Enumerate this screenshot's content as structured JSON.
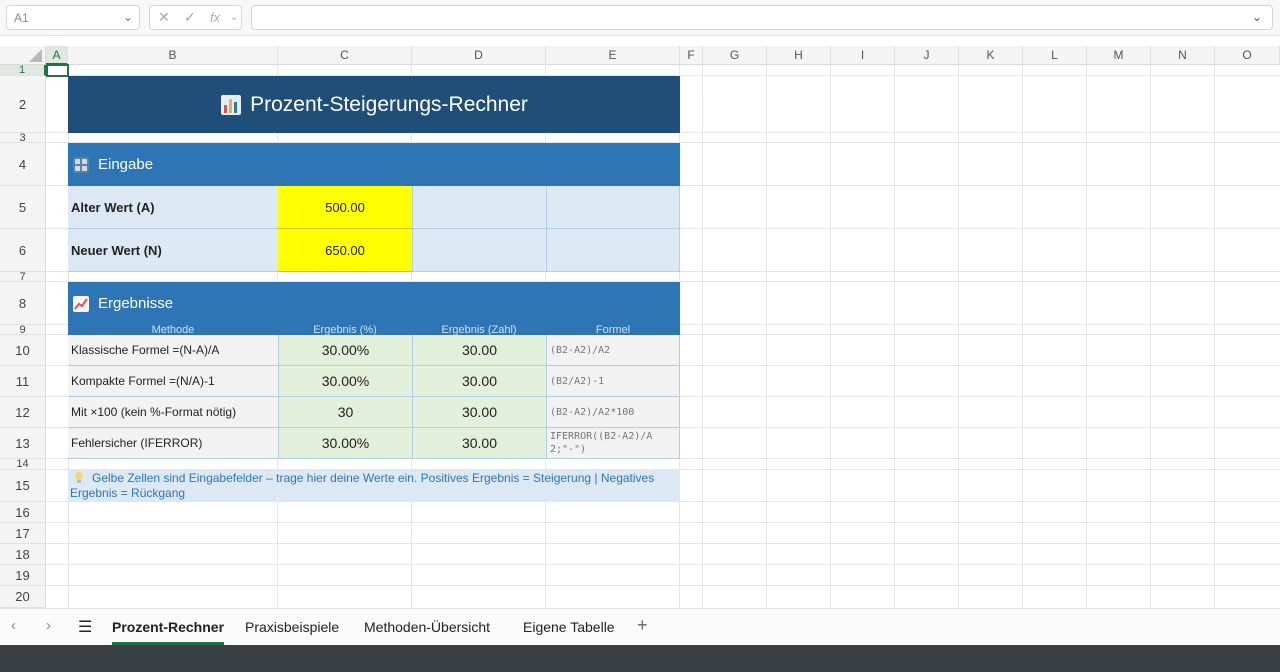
{
  "formula_bar": {
    "name_box": "A1",
    "fx_label": "fx",
    "formula_value": ""
  },
  "columns": [
    "A",
    "B",
    "C",
    "D",
    "E",
    "F",
    "G",
    "H",
    "I",
    "J",
    "K",
    "L",
    "M",
    "N",
    "O"
  ],
  "rows": [
    "1",
    "2",
    "3",
    "4",
    "5",
    "6",
    "7",
    "8",
    "9",
    "10",
    "11",
    "12",
    "13",
    "14",
    "15",
    "16",
    "17",
    "18",
    "19",
    "20"
  ],
  "sheet": {
    "title": "Prozent-Steigerungs-Rechner",
    "input_section": "Eingabe",
    "inputs": [
      {
        "label": "Alter Wert (A)",
        "value": "500.00"
      },
      {
        "label": "Neuer Wert (N)",
        "value": "650.00"
      }
    ],
    "results_section": "Ergebnisse",
    "result_headers": [
      "Methode",
      "Ergebnis (%)",
      "Ergebnis (Zahl)",
      "Formel"
    ],
    "results": [
      {
        "method": "Klassische Formel  =(N-A)/A",
        "percent": "30.00%",
        "number": "30.00",
        "formula": "(B2-A2)/A2"
      },
      {
        "method": "Kompakte Formel  =(N/A)-1",
        "percent": "30.00%",
        "number": "30.00",
        "formula": "(B2/A2)-1"
      },
      {
        "method": "Mit ×100 (kein %-Format nötig)",
        "percent": "30",
        "number": "30.00",
        "formula": "(B2-A2)/A2*100"
      },
      {
        "method": "Fehlersicher (IFERROR)",
        "percent": "30.00%",
        "number": "30.00",
        "formula": "IFERROR((B2-A2)/A2;\"-\")"
      }
    ],
    "note": "Gelbe Zellen sind Eingabefelder – trage hier deine Werte ein.  Positives Ergebnis = Steigerung  |  Negatives Ergebnis = Rückgang"
  },
  "tabs": [
    "Prozent-Rechner",
    "Praxisbeispiele",
    "Methoden-Übersicht",
    "Eigene Tabelle"
  ],
  "active_tab": "Prozent-Rechner",
  "colors": {
    "title_bg": "#1f4e79",
    "section_bg": "#2e75b6",
    "input_yellow": "#ffff00",
    "result_green": "#e2efda",
    "label_blue": "#dce9f5",
    "accent": "#217346"
  }
}
